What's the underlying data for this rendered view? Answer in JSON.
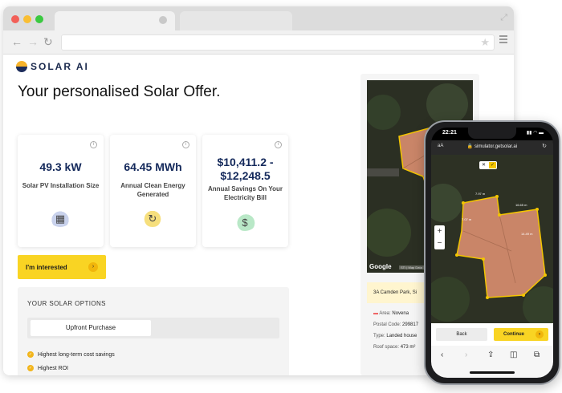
{
  "browser": {
    "url": ""
  },
  "page": {
    "logo_text": "SOLAR AI",
    "title": "Your personalised Solar Offer.",
    "stats": [
      {
        "value": "49.3 kW",
        "label": "Solar PV Installation Size",
        "icon": "solar-panel-icon"
      },
      {
        "value": "64.45 MWh",
        "label": "Annual Clean Energy Generated",
        "icon": "energy-cycle-icon"
      },
      {
        "value": "$10,411.2 - $12,248.5",
        "label": "Annual Savings On Your Electricity Bill",
        "icon": "money-bag-icon"
      }
    ],
    "cta_label": "I'm interested",
    "options": {
      "title": "YOUR SOLAR OPTIONS",
      "active_tab": "Upfront Purchase",
      "benefits": [
        "Highest long-term cost savings",
        "Highest ROI"
      ]
    },
    "map": {
      "google_label": "Google",
      "map_data_label": "STI | Map Data"
    },
    "property": {
      "address": "3A Camden Park, Si",
      "area_label": "Area:",
      "area": "Novena",
      "postal_label": "Postal Code:",
      "postal": "299817",
      "type_label": "Type:",
      "type": "Landed house",
      "roof_label": "Roof space:",
      "roof": "473 m²"
    }
  },
  "phone": {
    "time": "22:21",
    "status_icons": "▮▮ ◠ ▬",
    "aa": "aA",
    "url": "🔒 simulator.getsolar.ai",
    "edge_labels": [
      "7.97 m",
      "16.65 m",
      "7.07 m",
      "14.49 m"
    ],
    "back_label": "Back",
    "continue_label": "Continue"
  },
  "colors": {
    "accent": "#f9d423",
    "brand_navy": "#14295b",
    "roof": "#c98568",
    "roof_outline": "#f3c500"
  }
}
